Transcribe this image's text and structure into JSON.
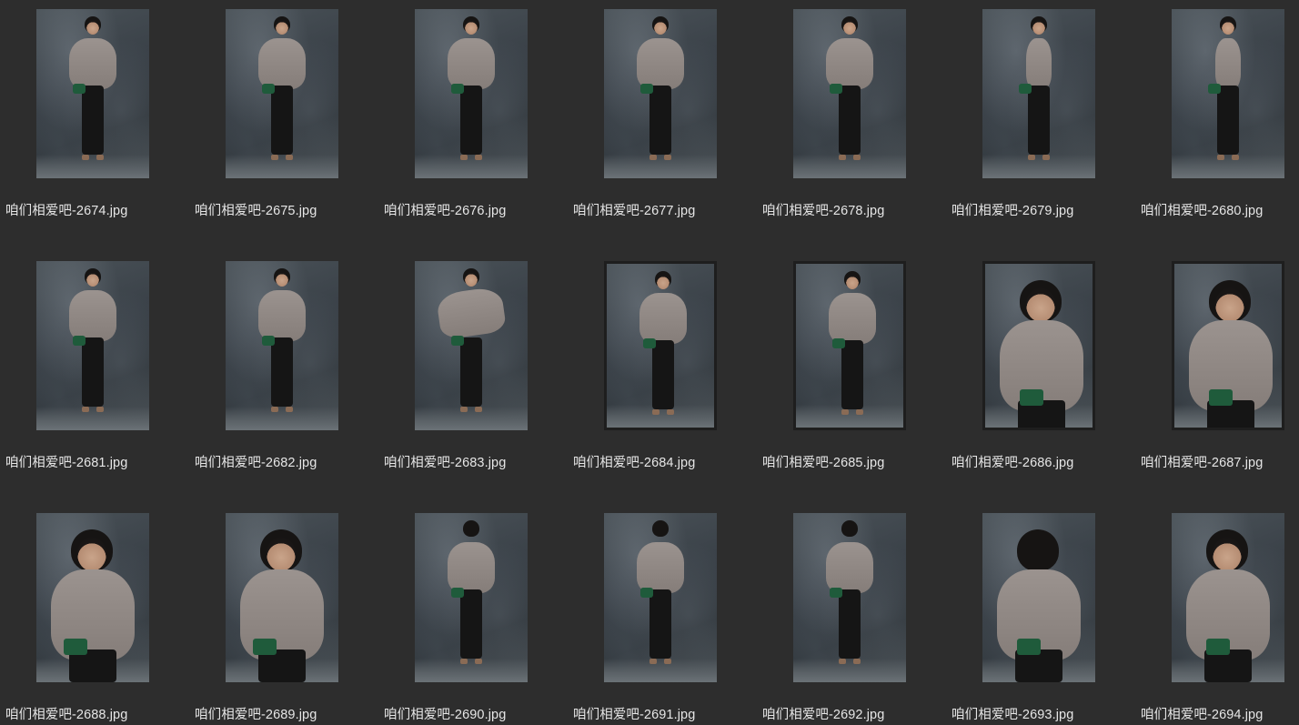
{
  "files": [
    {
      "name": "咱们相爱吧-2674.jpg",
      "pose": "front-full"
    },
    {
      "name": "咱们相爱吧-2675.jpg",
      "pose": "front-full"
    },
    {
      "name": "咱们相爱吧-2676.jpg",
      "pose": "front-full"
    },
    {
      "name": "咱们相爱吧-2677.jpg",
      "pose": "front-full"
    },
    {
      "name": "咱们相爱吧-2678.jpg",
      "pose": "front-full"
    },
    {
      "name": "咱们相爱吧-2679.jpg",
      "pose": "side-full"
    },
    {
      "name": "咱们相爱吧-2680.jpg",
      "pose": "side-full"
    },
    {
      "name": "咱们相爱吧-2681.jpg",
      "pose": "front-full"
    },
    {
      "name": "咱们相爱吧-2682.jpg",
      "pose": "front-full"
    },
    {
      "name": "咱们相爱吧-2683.jpg",
      "pose": "twirl-full"
    },
    {
      "name": "咱们相爱吧-2684.jpg",
      "pose": "front-full"
    },
    {
      "name": "咱们相爱吧-2685.jpg",
      "pose": "front-full"
    },
    {
      "name": "咱们相爱吧-2686.jpg",
      "pose": "front-half"
    },
    {
      "name": "咱们相爱吧-2687.jpg",
      "pose": "side-half"
    },
    {
      "name": "咱们相爱吧-2688.jpg",
      "pose": "profile-half"
    },
    {
      "name": "咱们相爱吧-2689.jpg",
      "pose": "profile-half"
    },
    {
      "name": "咱们相爱吧-2690.jpg",
      "pose": "back-full"
    },
    {
      "name": "咱们相爱吧-2691.jpg",
      "pose": "back-full"
    },
    {
      "name": "咱们相爱吧-2692.jpg",
      "pose": "back-full"
    },
    {
      "name": "咱们相爱吧-2693.jpg",
      "pose": "back-half"
    },
    {
      "name": "咱们相爱吧-2694.jpg",
      "pose": "front-half"
    }
  ],
  "colors": {
    "background": "#2d2d2d",
    "label": "#e6e6e6",
    "sweater": "#8f8783",
    "pants": "#151515",
    "bag": "#1f5b3b",
    "backdrop": "#3a4148"
  }
}
